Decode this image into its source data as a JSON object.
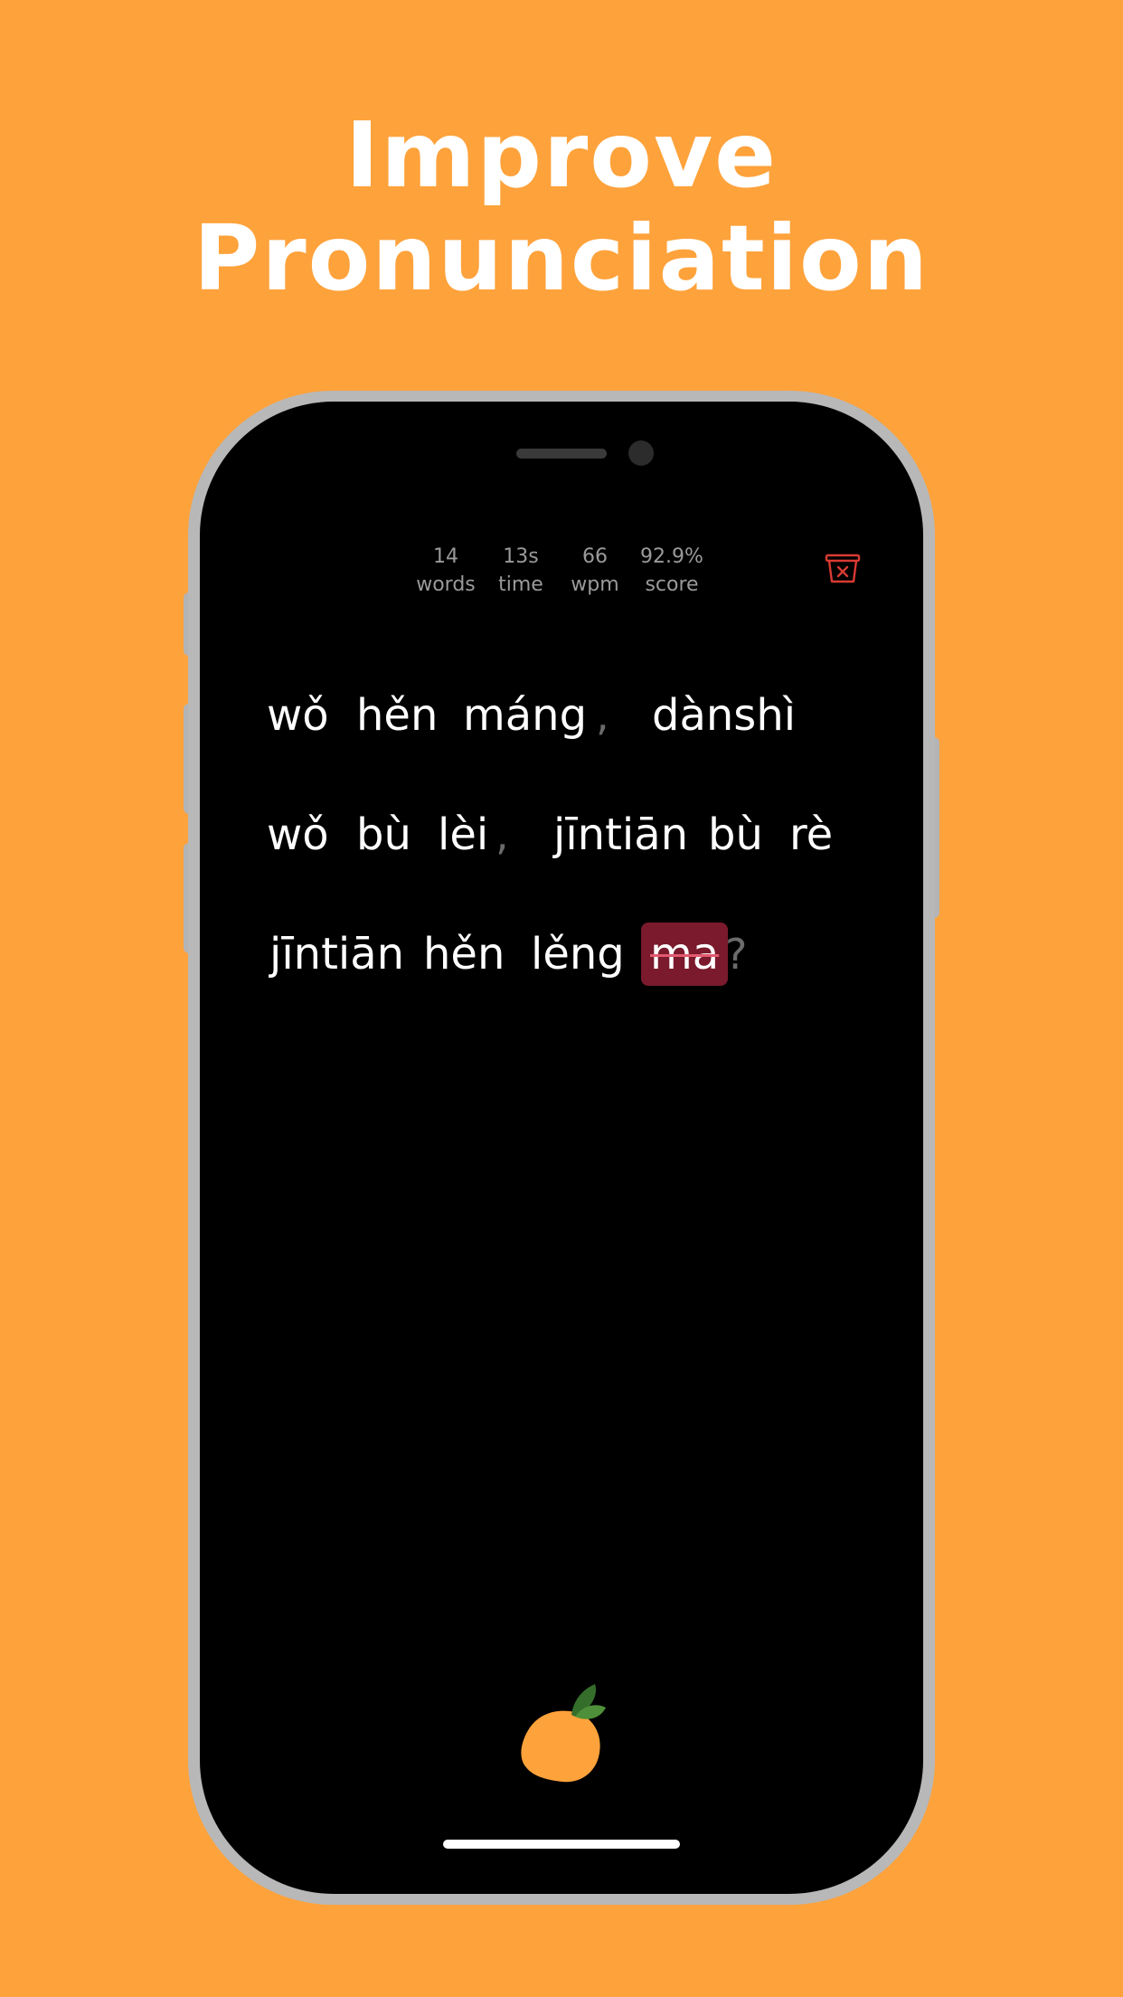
{
  "headline": {
    "line1": "Improve",
    "line2": "Pronunciation"
  },
  "stats": [
    {
      "value": "14",
      "label": "words"
    },
    {
      "value": "13s",
      "label": "time"
    },
    {
      "value": "66",
      "label": "wpm"
    },
    {
      "value": "92.9%",
      "label": "score"
    }
  ],
  "icons": {
    "trash": "trash-icon",
    "logo": "orange-fruit-icon"
  },
  "colors": {
    "background": "#FEA23B",
    "screen": "#000000",
    "error_highlight": "#7A1A2C",
    "trash_red": "#D93A33",
    "punctuation": "#6B6B6B"
  },
  "lines": [
    {
      "words": [
        "wǒ",
        "hěn",
        "máng",
        "dànshì"
      ],
      "punct": [
        ","
      ]
    },
    {
      "words": [
        "wǒ",
        "bù",
        "lèi",
        "jīntiān",
        "bù",
        "rè"
      ],
      "punct": [
        ","
      ]
    },
    {
      "words": [
        "jīntiān",
        "hěn",
        "lěng",
        "ma"
      ],
      "punct": [
        "?"
      ],
      "error_word": "ma"
    }
  ]
}
